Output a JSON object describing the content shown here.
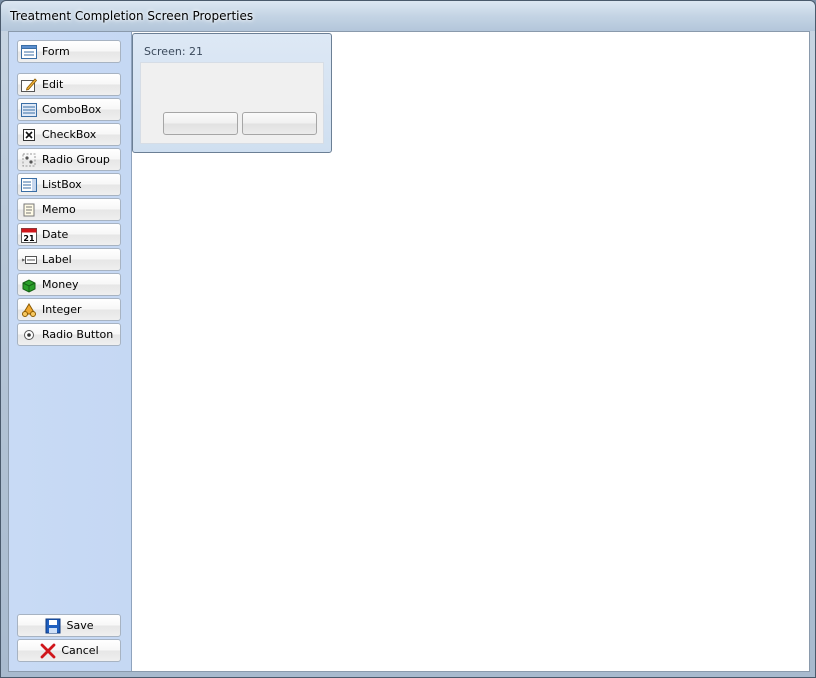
{
  "window": {
    "title": "Treatment Completion Screen Properties"
  },
  "sidebar": {
    "items": [
      {
        "label": "Form",
        "icon": "form-icon"
      },
      {
        "label": "Edit",
        "icon": "edit-icon"
      },
      {
        "label": "ComboBox",
        "icon": "combobox-icon"
      },
      {
        "label": "CheckBox",
        "icon": "checkbox-icon"
      },
      {
        "label": "Radio Group",
        "icon": "radio-group-icon"
      },
      {
        "label": "ListBox",
        "icon": "listbox-icon"
      },
      {
        "label": "Memo",
        "icon": "memo-icon"
      },
      {
        "label": "Date",
        "icon": "calendar-icon",
        "icon_text": "21"
      },
      {
        "label": "Label",
        "icon": "label-icon"
      },
      {
        "label": "Money",
        "icon": "money-icon"
      },
      {
        "label": "Integer",
        "icon": "integer-icon"
      },
      {
        "label": "Radio Button",
        "icon": "radio-button-icon"
      }
    ],
    "save_label": "Save",
    "cancel_label": "Cancel"
  },
  "screen": {
    "caption": "Screen: 21",
    "buttons": [
      "",
      ""
    ]
  },
  "colors": {
    "sidebar_bg": "#c8daf5",
    "panel_header": "#d8e5f3",
    "panel_body": "#f0f0f0",
    "cancel_red": "#d0161b",
    "save_blue": "#1f5fbf",
    "money_green": "#2aa02a"
  }
}
